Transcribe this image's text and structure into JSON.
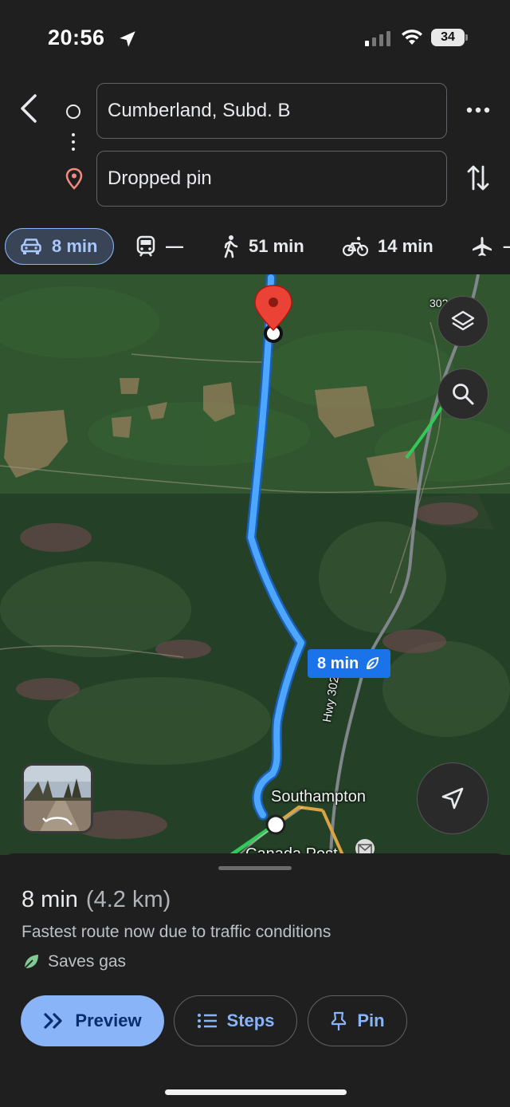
{
  "status_bar": {
    "time": "20:56",
    "battery": "34"
  },
  "directions": {
    "origin": "Cumberland, Subd. B",
    "destination": "Dropped pin"
  },
  "modes": {
    "drive": "8 min",
    "transit": "—",
    "walk": "51 min",
    "bike": "14 min",
    "fly": "–"
  },
  "map": {
    "route_time": "8 min",
    "labels": {
      "town": "Southampton",
      "post_office": "Canada Post",
      "highway": "Hwy 302",
      "road_shield": "302"
    }
  },
  "route_summary": {
    "duration": "8 min",
    "distance": "(4.2 km)",
    "note": "Fastest route now due to traffic conditions",
    "eco": "Saves gas"
  },
  "actions": {
    "preview": "Preview",
    "steps": "Steps",
    "pin": "Pin"
  },
  "colors": {
    "route": "#4da6ff",
    "accent": "#8ab4f8",
    "pin": "#ea4335"
  }
}
